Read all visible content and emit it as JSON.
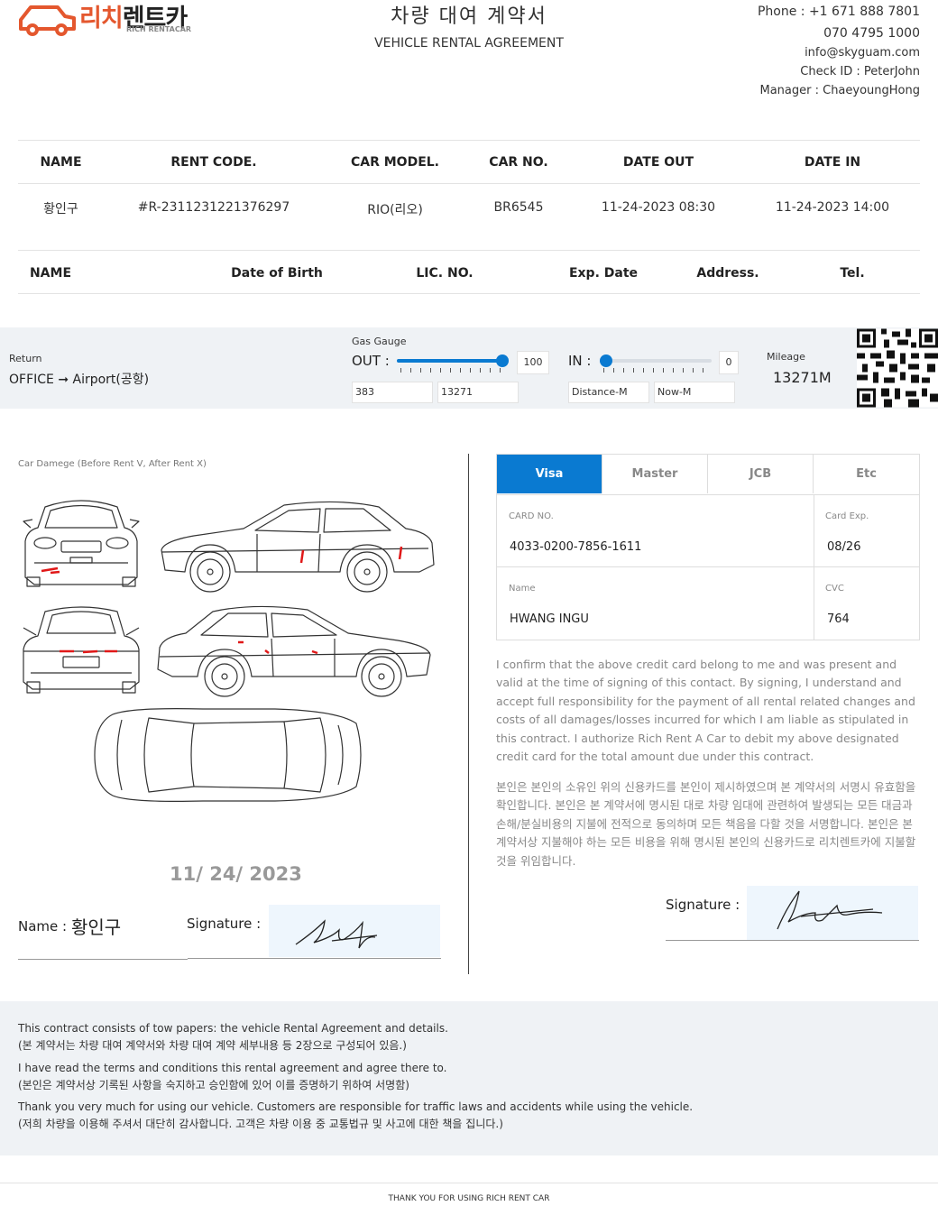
{
  "header": {
    "logo_text_red": "리치",
    "logo_text_dark": "렌트카",
    "logo_sub": "RICH RENTACAR",
    "title_ko": "차량 대여 계약서",
    "title_en": "VEHICLE RENTAL AGREEMENT",
    "phone1": "Phone : +1 671 888 7801",
    "phone2": "070 4795 1000",
    "email": "info@skyguam.com",
    "check_id": "Check ID : PeterJohn",
    "manager": "Manager : ChaeyoungHong"
  },
  "rental_table": {
    "headers": [
      "NAME",
      "RENT CODE.",
      "CAR MODEL.",
      "CAR NO.",
      "DATE OUT",
      "DATE IN"
    ],
    "row": [
      "황인구",
      "#R-2311231221376297",
      "RIO(리오)",
      "BR6545",
      "11-24-2023 08:30",
      "11-24-2023 14:00"
    ]
  },
  "driver_table": {
    "headers": [
      "NAME",
      "Date of Birth",
      "LIC. NO.",
      "Exp. Date",
      "Address.",
      "Tel."
    ]
  },
  "return_band": {
    "return_label": "Return",
    "return_value": "OFFICE ➞ Airport(공항)",
    "gas_label": "Gas Gauge",
    "out_label": "OUT :",
    "out_value": "100",
    "out_level": 1.0,
    "out_distance": "383",
    "out_now": "13271",
    "in_label": "IN :",
    "in_value": "0",
    "in_level": 0.0,
    "in_distance_placeholder": "Distance-M",
    "in_now_placeholder": "Now-M",
    "mileage_label": "Mileage",
    "mileage_value": "13271M"
  },
  "damage": {
    "caption": "Car Damege (Before Rent V, After Rent X)",
    "date": "11/ 24/ 2023",
    "name_label": "Name :",
    "name_value": "황인구",
    "signature_label": "Signature :"
  },
  "card": {
    "tabs": [
      "Visa",
      "Master",
      "JCB",
      "Etc"
    ],
    "active_tab": "Visa",
    "card_no_label": "CARD NO.",
    "card_no": "4033-0200-7856-1611",
    "exp_label": "Card Exp.",
    "exp": "08/26",
    "name_label": "Name",
    "name": "HWANG INGU",
    "cvc_label": "CVC",
    "cvc": "764",
    "confirm_en": "I confirm that the above credit card belong to me and was present and valid at the time of signing of this contact. By signing, I understand and accept full responsibility for the payment of all rental related changes and costs of all damages/losses incurred for which I am liable as stipulated in this contract. I authorize Rich Rent A Car to debit my above designated credit card for the total amount due under this contract.",
    "confirm_ko": "본인은 본인의 소유인 위의 신용카드를 본인이 제시하였으며 본 계약서의 서명시 유효함을 확인합니다. 본인은 본 계약서에 명시된 대로 차량 임대에 관련하여 발생되는 모든 대금과 손해/분실비용의 지불에 전적으로 동의하며 모든 책음을 다할 것을 서명합니다. 본인은 본 계약서상 지불해야 하는 모든 비용을 위해 명시된 본인의 신용카드로 리치렌트카에 지불할 것을 위임합니다.",
    "signature_label": "Signature :"
  },
  "footer": {
    "p1_en": "This contract consists of tow papers: the vehicle Rental Agreement and details.",
    "p1_ko": "(본 계약서는 차량 대여 계약서와 차량 대여 계약 세부내용 등 2장으로 구성되어 있음.)",
    "p2_en": "I have read the terms and conditions this rental agreement and agree there to.",
    "p2_ko": "(본인은 계약서상 기록된 사항을 숙지하고 승인함에 있어 이를 증명하기 위하여 서명함)",
    "p3_en": "Thank you very much for using our vehicle. Customers are responsible for traffic laws and accidents while using the vehicle.",
    "p3_ko": "(저희 차량을 이용해 주셔서 대단히 감사합니다. 고객은 차량 이용 중 교통법규 및 사고에 대한 책을 집니다.)",
    "thanks": "THANK YOU FOR USING RICH RENT CAR"
  },
  "colors": {
    "accent": "#0a7ad1",
    "logo_red": "#e4572e",
    "damage_mark": "#e01818",
    "band_bg": "#eff2f5",
    "signature_bg": "#eef6fd"
  }
}
